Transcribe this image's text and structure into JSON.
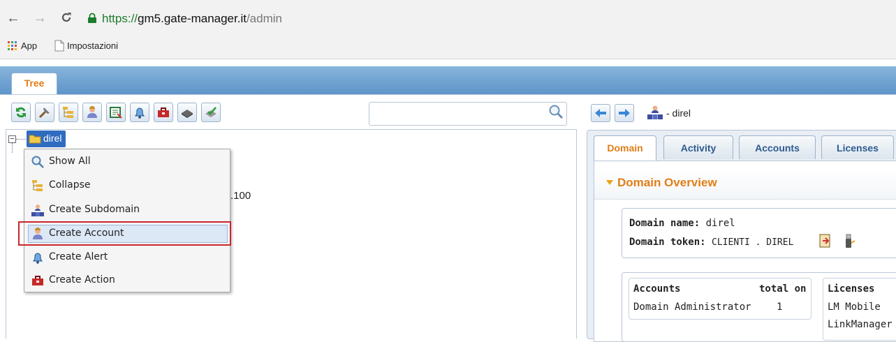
{
  "browser": {
    "url_scheme": "https://",
    "url_host": "gm5.gate-manager.it",
    "url_path": "/admin",
    "bookmarks": [
      {
        "label": "App",
        "icon": "apps-grid-icon"
      },
      {
        "label": "Impostazioni",
        "icon": "page-icon"
      }
    ]
  },
  "app": {
    "tab_tree_label": "Tree",
    "toolbar": [
      {
        "name": "refresh-button",
        "icon": "refresh-icon"
      },
      {
        "name": "tools-button",
        "icon": "tools-icon"
      },
      {
        "name": "tree-view-button",
        "icon": "tree-icon"
      },
      {
        "name": "user-button",
        "icon": "user-icon"
      },
      {
        "name": "form-button",
        "icon": "form-icon"
      },
      {
        "name": "alert-button",
        "icon": "bell-icon"
      },
      {
        "name": "action-button",
        "icon": "toolbox-icon"
      },
      {
        "name": "disk-button",
        "icon": "disk-icon"
      },
      {
        "name": "check-button",
        "icon": "check-icon"
      }
    ],
    "search_placeholder": "",
    "tree": {
      "node_label": "direl",
      "ip_fragment": ".100"
    },
    "context_menu": [
      {
        "label": "Show All",
        "icon": "magnifier-icon"
      },
      {
        "label": "Collapse",
        "icon": "tree-icon"
      },
      {
        "label": "Create Subdomain",
        "icon": "network-icon"
      },
      {
        "label": "Create Account",
        "icon": "user-icon",
        "highlighted": true
      },
      {
        "label": "Create Alert",
        "icon": "bell-icon"
      },
      {
        "label": "Create Action",
        "icon": "toolbox-icon"
      }
    ]
  },
  "right_panel": {
    "title": "- direl",
    "tabs": [
      "Domain",
      "Activity",
      "Accounts",
      "Licenses"
    ],
    "active_tab": "Domain",
    "section_title": "Domain Overview",
    "domain_name_label": "Domain name:",
    "domain_name_value": "direl",
    "domain_token_label": "Domain token:",
    "domain_token_value": "CLIENTI . DIREL",
    "accounts_header": "Accounts",
    "accounts_total_header": "total on",
    "accounts_row_label": "Domain Administrator",
    "accounts_row_value": "1",
    "licenses_header": "Licenses",
    "licenses": [
      "LM Mobile",
      "LinkManager"
    ]
  },
  "colors": {
    "accent_orange": "#e27e17",
    "header_blue": "#5e95c9",
    "highlight_red": "#c9262b",
    "selected_node": "#2f6cc0"
  }
}
